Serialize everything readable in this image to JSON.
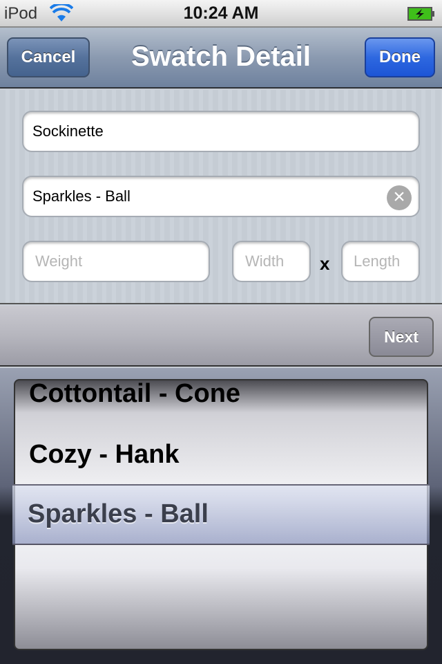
{
  "status_bar": {
    "carrier": "iPod",
    "time": "10:24 AM",
    "wifi_icon": "wifi-icon",
    "battery_icon": "battery-charging-icon"
  },
  "nav": {
    "title": "Swatch Detail",
    "cancel": "Cancel",
    "done": "Done"
  },
  "form": {
    "name_value": "Sockinette",
    "yarn_value": "Sparkles - Ball",
    "weight_placeholder": "Weight",
    "width_placeholder": "Width",
    "times": "x",
    "length_placeholder": "Length"
  },
  "toolbar": {
    "next": "Next"
  },
  "picker": {
    "items": [
      "Cottontail - Cone",
      "Cozy - Hank",
      "Sparkles - Ball"
    ],
    "selected": "Sparkles - Ball"
  },
  "colors": {
    "done_button": "#2e68e0",
    "nav_bar": "#8b9ab0"
  }
}
